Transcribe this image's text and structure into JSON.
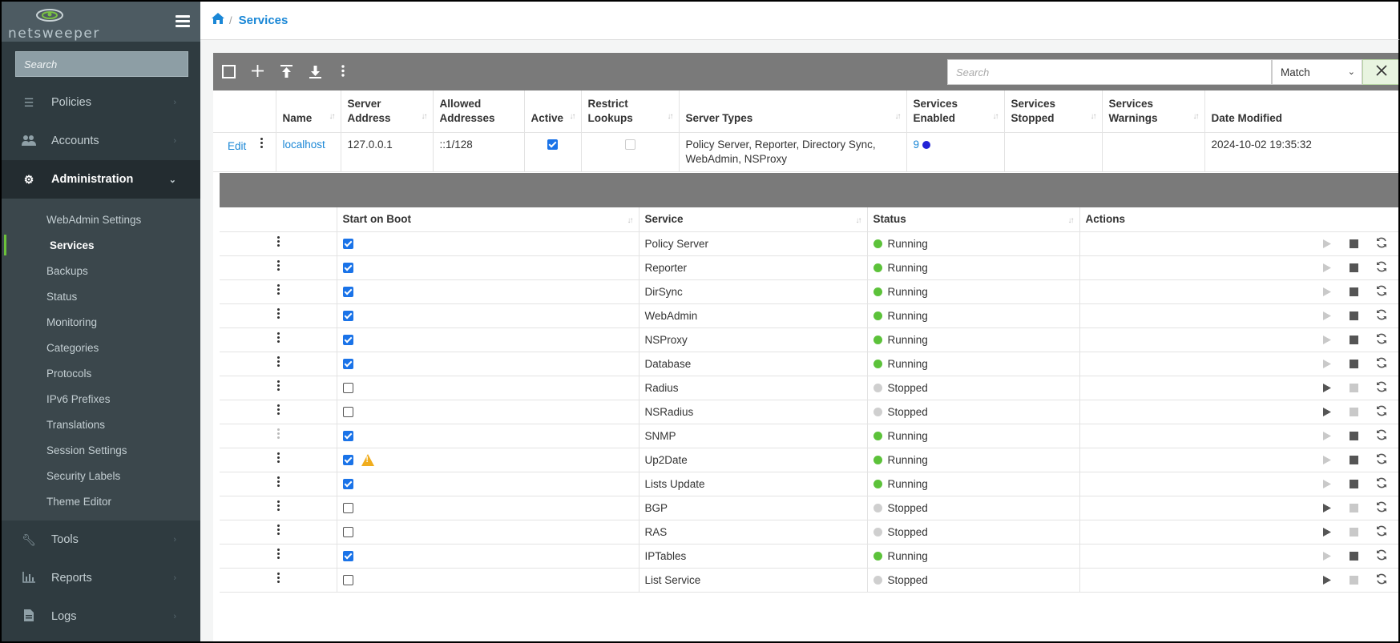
{
  "brand": {
    "name": "netsweeper"
  },
  "sidebar": {
    "search_placeholder": "Search",
    "nav": [
      {
        "label": "Policies",
        "icon": "sliders-icon"
      },
      {
        "label": "Accounts",
        "icon": "users-icon"
      },
      {
        "label": "Administration",
        "icon": "gears-icon"
      }
    ],
    "admin_items": [
      "WebAdmin Settings",
      "Services",
      "Backups",
      "Status",
      "Monitoring",
      "Categories",
      "Protocols",
      "IPv6 Prefixes",
      "Translations",
      "Session Settings",
      "Security Labels",
      "Theme Editor"
    ],
    "nav_bottom": [
      {
        "label": "Tools",
        "icon": "wrench-icon"
      },
      {
        "label": "Reports",
        "icon": "bar-chart-icon"
      },
      {
        "label": "Logs",
        "icon": "file-icon"
      }
    ]
  },
  "breadcrumb": {
    "current": "Services"
  },
  "toolbar": {
    "search_placeholder": "Search",
    "match_value": "Match"
  },
  "server_table": {
    "headers": [
      "Name",
      "Server Address",
      "Allowed Addresses",
      "Active",
      "Restrict Lookups",
      "Server Types",
      "Services Enabled",
      "Services Stopped",
      "Services Warnings",
      "Date Modified"
    ],
    "row": {
      "edit": "Edit",
      "name": "localhost",
      "address": "127.0.0.1",
      "allowed": "::1/128",
      "server_types": "Policy Server, Reporter, Directory Sync, WebAdmin, NSProxy",
      "services_enabled": "9",
      "date": "2024-10-02 19:35:32"
    }
  },
  "services_table": {
    "headers": [
      "Start on Boot",
      "Service",
      "Status",
      "Actions"
    ],
    "rows": [
      {
        "service": "Policy Server",
        "boot": true,
        "status": "Running"
      },
      {
        "service": "Reporter",
        "boot": true,
        "status": "Running"
      },
      {
        "service": "DirSync",
        "boot": true,
        "status": "Running"
      },
      {
        "service": "WebAdmin",
        "boot": true,
        "status": "Running"
      },
      {
        "service": "NSProxy",
        "boot": true,
        "status": "Running"
      },
      {
        "service": "Database",
        "boot": true,
        "status": "Running"
      },
      {
        "service": "Radius",
        "boot": false,
        "status": "Stopped"
      },
      {
        "service": "NSRadius",
        "boot": false,
        "status": "Stopped"
      },
      {
        "service": "SNMP",
        "boot": true,
        "status": "Running",
        "menu_faint": true
      },
      {
        "service": "Up2Date",
        "boot": true,
        "status": "Running",
        "warning": true
      },
      {
        "service": "Lists Update",
        "boot": true,
        "status": "Running"
      },
      {
        "service": "BGP",
        "boot": false,
        "status": "Stopped"
      },
      {
        "service": "RAS",
        "boot": false,
        "status": "Stopped"
      },
      {
        "service": "IPTables",
        "boot": true,
        "status": "Running"
      },
      {
        "service": "List Service",
        "boot": false,
        "status": "Stopped"
      }
    ]
  },
  "colors": {
    "running": "#5cc23a",
    "stopped": "#cfcfcf",
    "accent": "#1a87d6",
    "active_bar": "#6cc23a",
    "enabled_dot": "#2323d6"
  }
}
